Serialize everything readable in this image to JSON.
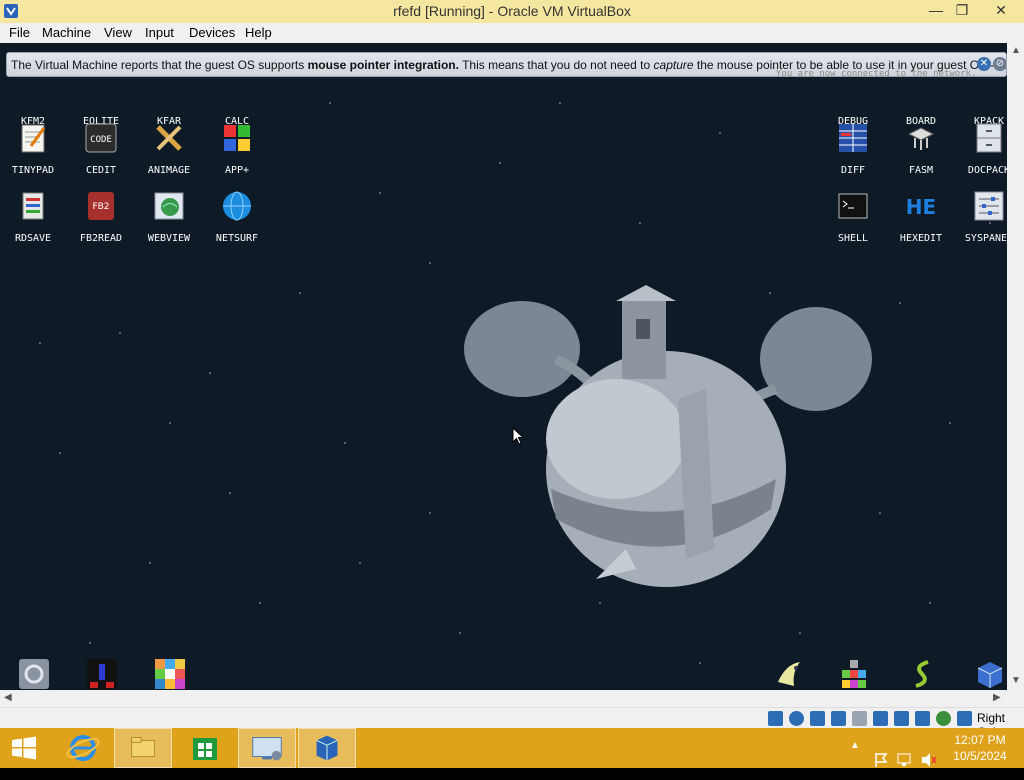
{
  "window": {
    "title": "rfefd [Running] - Oracle VM VirtualBox",
    "min_glyph": "—",
    "max_glyph": "❐",
    "close_glyph": "✕"
  },
  "menu": [
    "File",
    "Machine",
    "View",
    "Input",
    "Devices",
    "Help"
  ],
  "notification": {
    "part1": "The Virtual Machine reports that the guest OS supports ",
    "bold": "mouse pointer integration.",
    "part2": " This means that you do not need to ",
    "italic": "capture",
    "part3": " the mouse pointer to be able to use it in your guest OS -- all mouse",
    "network_message": "You are now connected to the network."
  },
  "desktop_icons_left": [
    [
      "KFM2",
      "EOLITE",
      "KFAR",
      "CALC"
    ],
    [
      "TINYPAD",
      "CEDIT",
      "ANIMAGE",
      "APP+"
    ],
    [
      "RDSAVE",
      "FB2READ",
      "WEBVIEW",
      "NETSURF"
    ]
  ],
  "desktop_icons_right": [
    [
      "DEBUG",
      "BOARD",
      "KPACK"
    ],
    [
      "DIFF",
      "FASM",
      "DOCPACK"
    ],
    [
      "SHELL",
      "HEXEDIT",
      "SYSPANEL"
    ]
  ],
  "icon_text": {
    "cedit": "CODE",
    "fb2read": "FB2",
    "hexedit": "HE"
  },
  "statusbar": {
    "host_key": "Right Ctrl"
  },
  "taskbar": {
    "time": "12:07 PM",
    "date": "10/5/2024"
  },
  "colors": {
    "titlebar": "#f5e6a0",
    "desktop": "#0e1b26",
    "taskbar": "#dfa31b"
  }
}
